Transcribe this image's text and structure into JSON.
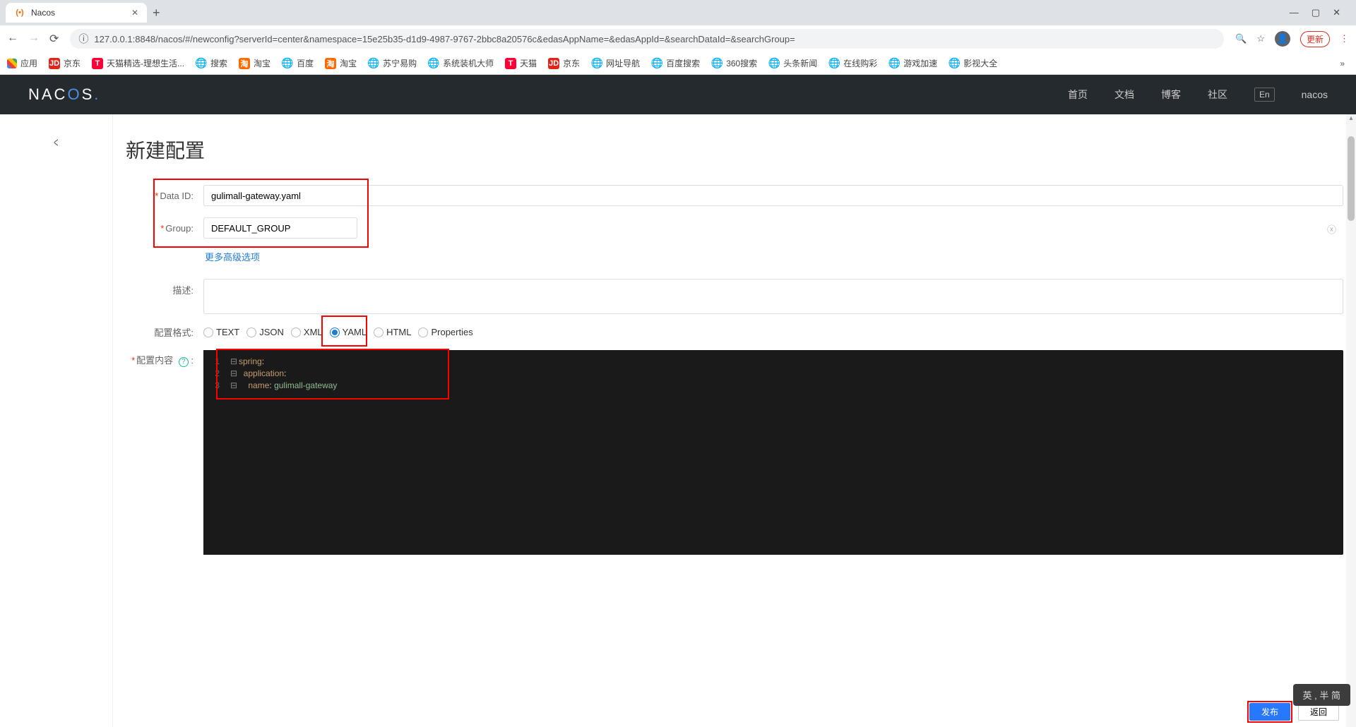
{
  "browser": {
    "tab_title": "Nacos",
    "url": "127.0.0.1:8848/nacos/#/newconfig?serverId=center&namespace=15e25b35-d1d9-4987-9767-2bbc8a20576c&edasAppName=&edasAppId=&searchDataId=&searchGroup=",
    "update_label": "更新",
    "bookmarks": [
      {
        "label": "应用",
        "icon_class": "apps-icon"
      },
      {
        "label": "京东",
        "icon_class": "jd-icon",
        "icon_text": "JD"
      },
      {
        "label": "天猫精选-理想生活...",
        "icon_class": "tmall-icon",
        "icon_text": "T"
      },
      {
        "label": "搜索",
        "icon_class": "globe-icon",
        "icon_text": "🌐"
      },
      {
        "label": "淘宝",
        "icon_class": "tb-icon",
        "icon_text": "淘"
      },
      {
        "label": "百度",
        "icon_class": "globe-icon",
        "icon_text": "🌐"
      },
      {
        "label": "淘宝",
        "icon_class": "tb-icon",
        "icon_text": "淘"
      },
      {
        "label": "苏宁易购",
        "icon_class": "globe-icon",
        "icon_text": "🌐"
      },
      {
        "label": "系统装机大师",
        "icon_class": "globe-icon",
        "icon_text": "🌐"
      },
      {
        "label": "天猫",
        "icon_class": "tmall-icon",
        "icon_text": "T"
      },
      {
        "label": "京东",
        "icon_class": "jd-icon",
        "icon_text": "JD"
      },
      {
        "label": "网址导航",
        "icon_class": "globe-icon",
        "icon_text": "🌐"
      },
      {
        "label": "百度搜索",
        "icon_class": "globe-icon",
        "icon_text": "🌐"
      },
      {
        "label": "360搜索",
        "icon_class": "globe-icon",
        "icon_text": "🌐"
      },
      {
        "label": "头条新闻",
        "icon_class": "globe-icon",
        "icon_text": "🌐"
      },
      {
        "label": "在线购彩",
        "icon_class": "globe-icon",
        "icon_text": "🌐"
      },
      {
        "label": "游戏加速",
        "icon_class": "globe-icon",
        "icon_text": "🌐"
      },
      {
        "label": "影视大全",
        "icon_class": "globe-icon",
        "icon_text": "🌐"
      }
    ]
  },
  "nacos": {
    "logo_text": "NACOS.",
    "nav": {
      "home": "首页",
      "docs": "文档",
      "blog": "博客",
      "community": "社区",
      "lang": "En",
      "user": "nacos"
    }
  },
  "page": {
    "title": "新建配置",
    "form": {
      "data_id_label": "Data ID:",
      "data_id_value": "gulimall-gateway.yaml",
      "group_label": "Group:",
      "group_value": "DEFAULT_GROUP",
      "more_options": "更多高级选项",
      "desc_label": "描述:",
      "format_label": "配置格式:",
      "content_label": "配置内容",
      "formats": [
        "TEXT",
        "JSON",
        "XML",
        "YAML",
        "HTML",
        "Properties"
      ],
      "selected_format": "YAML"
    },
    "editor": {
      "lines": [
        {
          "num": "1",
          "indent": "",
          "key": "spring",
          "val": ""
        },
        {
          "num": "2",
          "indent": "  ",
          "key": "application",
          "val": ""
        },
        {
          "num": "3",
          "indent": "    ",
          "key": "name",
          "val": "gulimall-gateway"
        }
      ]
    },
    "actions": {
      "publish": "发布",
      "back": "返回"
    }
  },
  "ime": {
    "text": "英 , 半 简"
  }
}
